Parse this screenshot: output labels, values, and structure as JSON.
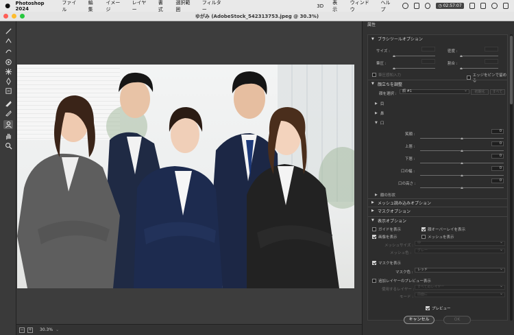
{
  "menubar": {
    "app_name": "Photoshop 2024",
    "items_left": [
      "ファイル",
      "編集",
      "イメージ",
      "レイヤー",
      "書式",
      "選択範囲",
      "フィルター"
    ],
    "items_right": [
      "3D",
      "表示",
      "ウィンドウ",
      "ヘルプ"
    ],
    "time": "02:57:07"
  },
  "window": {
    "title": "ゆがみ (AdobeStock_542313753.jpeg @ 30.3%)"
  },
  "canvas": {
    "zoom": "30.3%"
  },
  "panel": {
    "title": "属性",
    "brush_section": "ブラシツールオプション",
    "size_label": "サイズ :",
    "density_label": "密度 :",
    "pressure_label": "筆圧 :",
    "rate_label": "割合 :",
    "stylus_label": "筆圧感知入力",
    "pin_edges_label": "エッジをピンで留める",
    "face_section": "顔立ちを調整",
    "face_select_label": "顔を選択 :",
    "face_select_value": "顔 #1",
    "reset_label": "初期化",
    "all_label": "すべて",
    "eyes": "目",
    "nose": "鼻",
    "mouth": "口",
    "smile_label": "笑顔 :",
    "upper_lip_label": "上唇 :",
    "lower_lip_label": "下唇 :",
    "mouth_width_label": "口の幅 :",
    "mouth_height_label": "口の高さ :",
    "smile_value": "0",
    "upper_lip_value": "0",
    "lower_lip_value": "0",
    "mouth_width_value": "0",
    "mouth_height_value": "0",
    "face_shape": "顔の形状",
    "mesh_section": "メッシュ読み込みオプション",
    "mask_options_section": "マスクオプション",
    "view_section": "表示オプション",
    "show_guide": "ガイドを表示",
    "face_overlay": "顔オーバーレイを表示",
    "show_image": "画像を表示",
    "show_mesh": "メッシュを表示",
    "mesh_size_label": "メッシュサイズ :",
    "mesh_size_value": "中",
    "mesh_color_label": "メッシュ色 :",
    "mesh_color_value": "グレー",
    "show_mask": "マスクを表示",
    "mask_color_label": "マスク色 :",
    "mask_color_value": "レッド",
    "backdrop_label": "追加レイヤーのプレビュー表示",
    "use_layer_label": "使用するレイヤー :",
    "use_layer_value": "すべてのレイヤー",
    "mode_label": "モード :",
    "mode_value": "前面に",
    "preview_label": "プレビュー",
    "cancel_label": "キャンセル",
    "ok_label": "OK"
  },
  "colors": {
    "close": "#ff5f57",
    "minimize": "#febc2e",
    "maximize": "#28c840"
  }
}
